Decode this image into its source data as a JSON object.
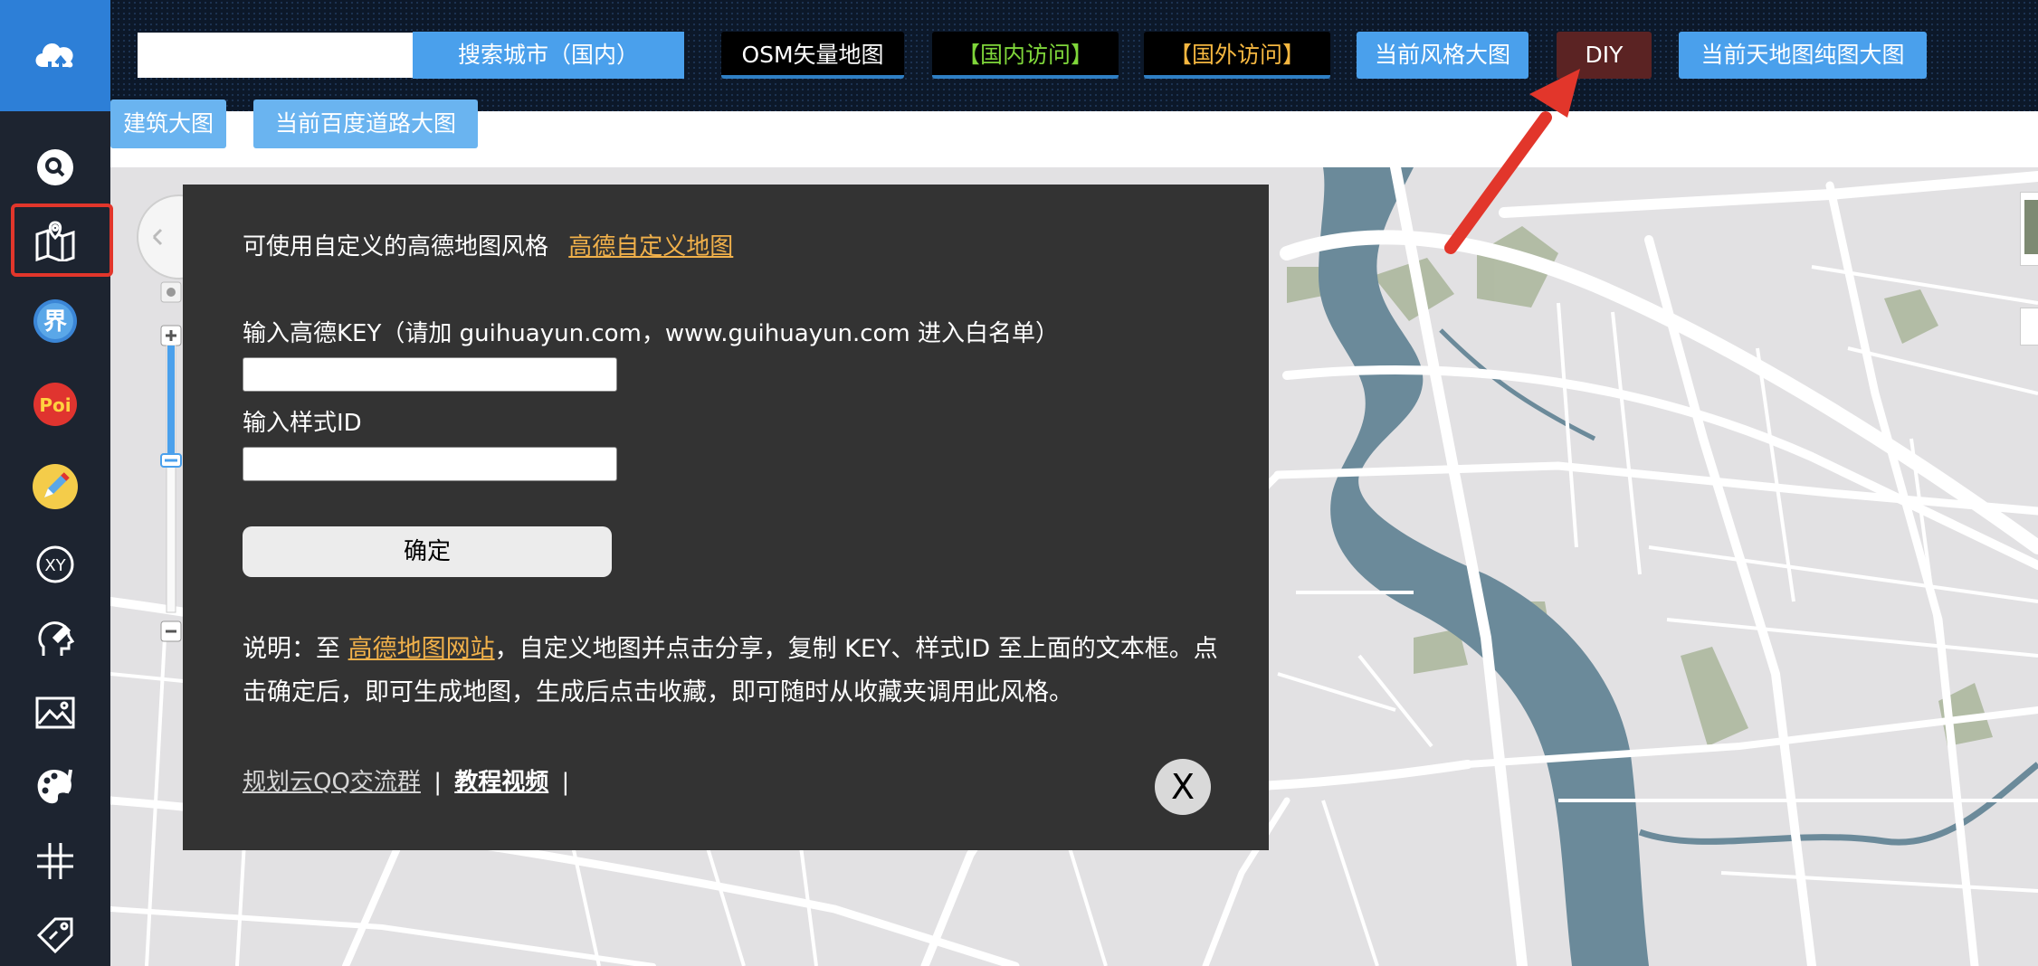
{
  "toolbar": {
    "search_placeholder": "",
    "search_button": "搜索城市（国内）",
    "osm_button": "OSM矢量地图",
    "domestic_button": "【国内访问】",
    "foreign_button": "【国外访问】",
    "style_big_button": "当前风格大图",
    "diy_button": "DIY",
    "tianditu_button": "当前天地图纯图大图",
    "building_button": "建筑大图",
    "baidu_road_button": "当前百度道路大图"
  },
  "sidebar": {
    "items": [
      {
        "icon": "search-icon"
      },
      {
        "icon": "map-icon",
        "highlighted": true
      },
      {
        "icon": "boundary-icon",
        "glyph": "界"
      },
      {
        "icon": "poi-icon",
        "glyph": "Poi"
      },
      {
        "icon": "pencil-icon"
      },
      {
        "icon": "coordinate-icon",
        "glyph": "XY"
      },
      {
        "icon": "head-brush-icon"
      },
      {
        "icon": "image-icon"
      },
      {
        "icon": "palette-icon"
      },
      {
        "icon": "grid-lines-icon"
      },
      {
        "icon": "tag-icon"
      }
    ]
  },
  "dialog": {
    "intro_text": "可使用自定义的高德地图风格",
    "intro_link": "高德自定义地图",
    "key_label": "输入高德KEY（请加 guihuayun.com，www.guihuayun.com 进入白名单）",
    "key_value": "",
    "style_label": "输入样式ID",
    "style_value": "",
    "confirm": "确定",
    "note_prefix": "说明：至 ",
    "note_link": "高德地图网站",
    "note_suffix": "，自定义地图并点击分享，复制 KEY、样式ID 至上面的文本框。点击确定后，即可生成地图，生成后点击收藏，即可随时从收藏夹调用此风格。",
    "qq_group_link": "规划云QQ交流群",
    "separator": "|",
    "video_link": "教程视频",
    "close": "X"
  },
  "colors": {
    "accent_blue": "#4aa0ec",
    "diy_red": "#5b2323",
    "domestic_green": "#7fd63a",
    "foreign_orange": "#f5b740",
    "arrow_red": "#e2362b",
    "river": "#6b8a9a",
    "park": "#a9b59a",
    "land": "#e3e3e3"
  }
}
